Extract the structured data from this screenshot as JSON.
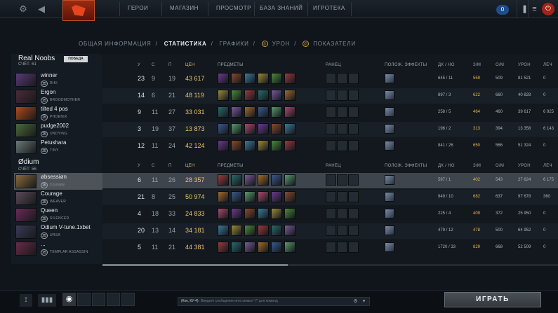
{
  "nav": {
    "items": [
      "ГЕРОИ",
      "МАГАЗИН",
      "ПРОСМОТР",
      "БАЗА ЗНАНИЙ",
      "ИГРОТЕКА"
    ],
    "notification_count": "0"
  },
  "subtabs": {
    "overview": "ОБЩАЯ ИНФОРМАЦИЯ",
    "stats": "СТАТИСТИКА",
    "graphs": "ГРАФИКИ",
    "damage": "УРОН",
    "indicators": "ПОКАЗАТЕЛИ"
  },
  "headers": {
    "k": "У",
    "d": "С",
    "a": "П",
    "networth": "ЦЕН",
    "items": "ПРЕДМЕТЫ",
    "backpack": "РАНЕЦ",
    "buffs": "ПОЛОЖ. ЭФФЕКТЫ",
    "lhdn": "ДК / НО",
    "gpm": "З/М",
    "xpm": "О/М",
    "damage": "УРОН",
    "heal": "ЛЕЧ"
  },
  "teams": [
    {
      "name": "Real Noobs",
      "score": "СЧЁТ: 61",
      "badge": "ПОБЕДА",
      "players": [
        {
          "name": "winner",
          "level": "25",
          "hero": "RIKI",
          "k": "23",
          "d": "9",
          "a": "19",
          "nw": "43 617",
          "lhdn": "645 / 11",
          "gpm": "559",
          "xpm": "509",
          "dmg": "81 521",
          "heal": "0"
        },
        {
          "name": "Ergon",
          "level": "25",
          "hero": "BROODMOTHER",
          "k": "14",
          "d": "6",
          "a": "21",
          "nw": "48 119",
          "lhdn": "897 / 3",
          "gpm": "622",
          "xpm": "660",
          "dmg": "40 828",
          "heal": "0"
        },
        {
          "name": "tilted 4 pos",
          "level": "25",
          "hero": "PHOENIX",
          "k": "9",
          "d": "11",
          "a": "27",
          "nw": "33 031",
          "lhdn": "258 / 5",
          "gpm": "464",
          "xpm": "460",
          "dmg": "39 617",
          "heal": "6 925"
        },
        {
          "name": "pudge2002",
          "level": "25",
          "hero": "UNDYING",
          "k": "3",
          "d": "19",
          "a": "37",
          "nw": "13 873",
          "lhdn": "196 / 2",
          "gpm": "313",
          "xpm": "394",
          "dmg": "13 358",
          "heal": "6 143"
        },
        {
          "name": "Petushara",
          "level": "25",
          "hero": "TINY",
          "k": "12",
          "d": "11",
          "a": "24",
          "nw": "42 124",
          "lhdn": "841 / 26",
          "gpm": "650",
          "xpm": "566",
          "dmg": "51 324",
          "heal": "0"
        }
      ]
    },
    {
      "name": "Ødium",
      "score": "СЧЁТ: 56",
      "badge": "",
      "players": [
        {
          "name": "øbsessiøn",
          "level": "25",
          "hero": "Courage",
          "k": "6",
          "d": "11",
          "a": "26",
          "nw": "28 357",
          "lhdn": "587 / 1",
          "gpm": "402",
          "xpm": "543",
          "dmg": "27 624",
          "heal": "6 175"
        },
        {
          "name": "Courage",
          "level": "25",
          "hero": "WEAVER",
          "k": "21",
          "d": "8",
          "a": "25",
          "nw": "50 974",
          "lhdn": "949 / 10",
          "gpm": "682",
          "xpm": "637",
          "dmg": "97 678",
          "heal": "360"
        },
        {
          "name": "Queen",
          "level": "25",
          "hero": "SILENCER",
          "k": "4",
          "d": "18",
          "a": "33",
          "nw": "24 833",
          "lhdn": "225 / 4",
          "gpm": "409",
          "xpm": "372",
          "dmg": "25 950",
          "heal": "0"
        },
        {
          "name": "Odium V-tune.1xbet",
          "level": "25",
          "hero": "URSA",
          "k": "20",
          "d": "13",
          "a": "14",
          "nw": "34 181",
          "lhdn": "479 / 12",
          "gpm": "478",
          "xpm": "500",
          "dmg": "64 952",
          "heal": "0"
        },
        {
          "name": "...",
          "level": "25",
          "hero": "TEMPLAR ASSASSIN",
          "k": "5",
          "d": "11",
          "a": "21",
          "nw": "44 381",
          "lhdn": "1720 / 33",
          "gpm": "829",
          "xpm": "668",
          "dmg": "52 509",
          "heal": "0"
        }
      ]
    }
  ],
  "chat": {
    "channel": "(Кек, КУ-4):",
    "placeholder": "Введите сообщение или символ \"/\" для команд"
  },
  "play_button": "ИГРАТЬ",
  "colors": {
    "gold": "#e8c26a",
    "accent_red": "#a32317",
    "selected_row": "#3e454c"
  }
}
